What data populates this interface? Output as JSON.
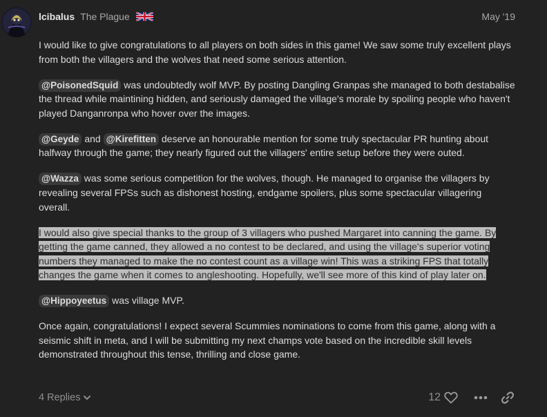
{
  "post": {
    "username": "lcibalus",
    "user_title": "The Plague",
    "flag_icon": "uk-flag-icon",
    "date": "May '19",
    "paragraphs": [
      {
        "text": "I would like to give congratulations to all players on both sides in this game! We saw some truly excellent plays from both the villagers and the wolves that need some serious attention."
      },
      {
        "mention": "@PoisonedSquid",
        "text": " was undoubtedly wolf MVP. By posting Dangling Granpas she managed to both destabalise the thread while maintining hidden, and seriously damaged the village's morale by spoiling people who haven't played Danganronpa who hover over the images."
      },
      {
        "mention1": "@Geyde",
        "and": " and ",
        "mention2": "@Kirefitten",
        "text": " deserve an honourable mention for some truly spectacular PR hunting about halfway through the game; they nearly figured out the villagers' entire setup before they were outed."
      },
      {
        "mention": "@Wazza",
        "text": " was some serious competition for the wolves, though. He managed to organise the villagers by revealing several FPSs such as dishonest hosting, endgame spoilers, plus some spectacular villagering overall."
      },
      {
        "text": "I would also give special thanks to the group of 3 villagers who pushed Margaret into canning the game. By getting the game canned, they allowed a no contest to be declared, and using the village's superior voting numbers they managed to make the no contest count as a village win! This was a striking FPS that totally changes the game when it comes to angleshooting. Hopefully, we'll see more of this kind of play later on."
      },
      {
        "mention": "@Hippoyeetus",
        "text": " was village MVP."
      },
      {
        "text": "Once again, congratulations! I expect several Scummies nominations to come from this game, along with a seismic shift in meta, and I will be submitting my next champs vote based on the incredible skill levels demonstrated throughout this tense, thrilling and close game."
      }
    ]
  },
  "footer": {
    "replies_label": "4 Replies",
    "replies_icon": "chevron-down-icon",
    "like_count": "12",
    "like_icon": "heart-icon",
    "more_icon": "ellipsis-icon",
    "share_icon": "link-icon"
  },
  "colors": {
    "background": "#222222",
    "text": "#dddddd",
    "muted": "#a9a9a9",
    "mention_bg": "#3a3a3a",
    "selection_bg": "#bdbdbd",
    "selection_text": "#2c2c2c"
  }
}
